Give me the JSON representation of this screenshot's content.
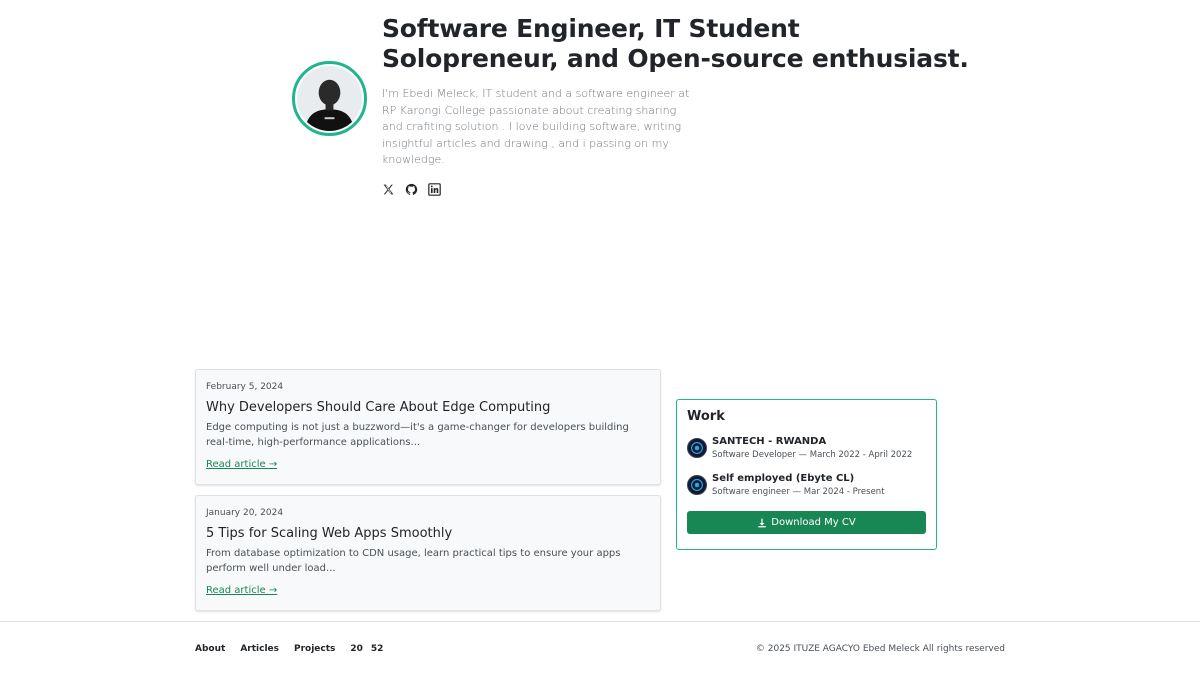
{
  "hero": {
    "title_line1": "Software Engineer, IT Student",
    "title_line2": "Solopreneur, and Open-source enthusiast.",
    "description": "I'm Ebedi Meleck, IT student and a software engineer at RP Karongi College passionate about creating sharing and crafiting solution . I love building software, writing insightful articles and drawing , and i passing on my knowledge.",
    "avatar_icon": "avatar-photo",
    "socials": [
      {
        "icon": "x-icon"
      },
      {
        "icon": "github-icon"
      },
      {
        "icon": "linkedin-icon"
      }
    ]
  },
  "articles": [
    {
      "date": "February 5, 2024",
      "title": "Why Developers Should Care About Edge Computing",
      "excerpt": "Edge computing is not just a buzzword—it's a game-changer for developers building real-time, high-performance applications...",
      "link": "Read article →"
    },
    {
      "date": "January 20, 2024",
      "title": "5 Tips for Scaling Web Apps Smoothly",
      "excerpt": "From database optimization to CDN usage, learn practical tips to ensure your apps perform well under load...",
      "link": "Read article →"
    }
  ],
  "work": {
    "title": "Work",
    "jobs": [
      {
        "company": "SANTECH - RWANDA",
        "role": "Software Developer — March 2022 - April 2022"
      },
      {
        "company": "Self employed (Ebyte CL)",
        "role": "Software engineer — Mar 2024 - Present"
      }
    ],
    "cv_button": "Download My CV"
  },
  "footer": {
    "nav": [
      "About",
      "Articles",
      "Projects",
      "20",
      "52"
    ],
    "copyright": "© 2025 ITUZE AGACYO Ebed Meleck All rights reserved"
  },
  "colors": {
    "accent": "#20b58f",
    "button": "#198754",
    "text": "#212529"
  }
}
